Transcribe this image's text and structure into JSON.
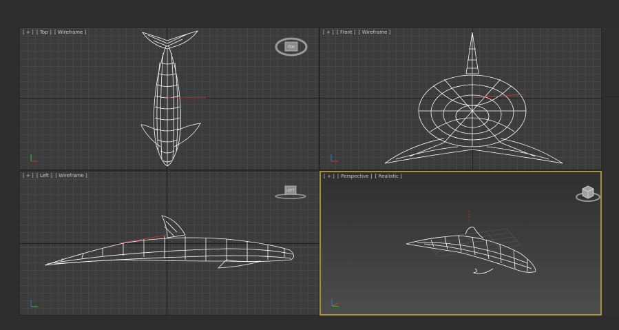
{
  "viewports": {
    "top": {
      "plus": "[ + ]",
      "view": "[ Top ]",
      "shading": "[ Wireframe ]",
      "viewcube_face": "TOP"
    },
    "front": {
      "plus": "[ + ]",
      "view": "[ Front ]",
      "shading": "[ Wireframe ]"
    },
    "left": {
      "plus": "[ + ]",
      "view": "[ Left ]",
      "shading": "[ Wireframe ]",
      "viewcube_face": "LEFT"
    },
    "perspective": {
      "plus": "[ + ]",
      "view": "[ Perspective ]",
      "shading": "[ Realistic ]",
      "active": true
    }
  },
  "colors": {
    "wire": "#ffffff",
    "active_border": "#a8913f",
    "axis_x": "#d23a3a",
    "axis_y": "#3ac23a",
    "axis_z": "#3a7ad2"
  }
}
